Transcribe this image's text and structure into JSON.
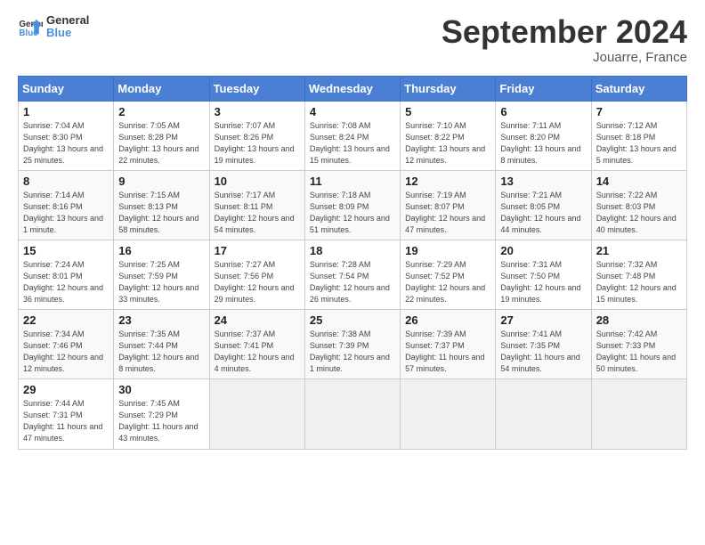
{
  "header": {
    "logo_general": "General",
    "logo_blue": "Blue",
    "month_title": "September 2024",
    "location": "Jouarre, France"
  },
  "days_of_week": [
    "Sunday",
    "Monday",
    "Tuesday",
    "Wednesday",
    "Thursday",
    "Friday",
    "Saturday"
  ],
  "weeks": [
    [
      {
        "day": "1",
        "sunrise": "Sunrise: 7:04 AM",
        "sunset": "Sunset: 8:30 PM",
        "daylight": "Daylight: 13 hours and 25 minutes."
      },
      {
        "day": "2",
        "sunrise": "Sunrise: 7:05 AM",
        "sunset": "Sunset: 8:28 PM",
        "daylight": "Daylight: 13 hours and 22 minutes."
      },
      {
        "day": "3",
        "sunrise": "Sunrise: 7:07 AM",
        "sunset": "Sunset: 8:26 PM",
        "daylight": "Daylight: 13 hours and 19 minutes."
      },
      {
        "day": "4",
        "sunrise": "Sunrise: 7:08 AM",
        "sunset": "Sunset: 8:24 PM",
        "daylight": "Daylight: 13 hours and 15 minutes."
      },
      {
        "day": "5",
        "sunrise": "Sunrise: 7:10 AM",
        "sunset": "Sunset: 8:22 PM",
        "daylight": "Daylight: 13 hours and 12 minutes."
      },
      {
        "day": "6",
        "sunrise": "Sunrise: 7:11 AM",
        "sunset": "Sunset: 8:20 PM",
        "daylight": "Daylight: 13 hours and 8 minutes."
      },
      {
        "day": "7",
        "sunrise": "Sunrise: 7:12 AM",
        "sunset": "Sunset: 8:18 PM",
        "daylight": "Daylight: 13 hours and 5 minutes."
      }
    ],
    [
      {
        "day": "8",
        "sunrise": "Sunrise: 7:14 AM",
        "sunset": "Sunset: 8:16 PM",
        "daylight": "Daylight: 13 hours and 1 minute."
      },
      {
        "day": "9",
        "sunrise": "Sunrise: 7:15 AM",
        "sunset": "Sunset: 8:13 PM",
        "daylight": "Daylight: 12 hours and 58 minutes."
      },
      {
        "day": "10",
        "sunrise": "Sunrise: 7:17 AM",
        "sunset": "Sunset: 8:11 PM",
        "daylight": "Daylight: 12 hours and 54 minutes."
      },
      {
        "day": "11",
        "sunrise": "Sunrise: 7:18 AM",
        "sunset": "Sunset: 8:09 PM",
        "daylight": "Daylight: 12 hours and 51 minutes."
      },
      {
        "day": "12",
        "sunrise": "Sunrise: 7:19 AM",
        "sunset": "Sunset: 8:07 PM",
        "daylight": "Daylight: 12 hours and 47 minutes."
      },
      {
        "day": "13",
        "sunrise": "Sunrise: 7:21 AM",
        "sunset": "Sunset: 8:05 PM",
        "daylight": "Daylight: 12 hours and 44 minutes."
      },
      {
        "day": "14",
        "sunrise": "Sunrise: 7:22 AM",
        "sunset": "Sunset: 8:03 PM",
        "daylight": "Daylight: 12 hours and 40 minutes."
      }
    ],
    [
      {
        "day": "15",
        "sunrise": "Sunrise: 7:24 AM",
        "sunset": "Sunset: 8:01 PM",
        "daylight": "Daylight: 12 hours and 36 minutes."
      },
      {
        "day": "16",
        "sunrise": "Sunrise: 7:25 AM",
        "sunset": "Sunset: 7:59 PM",
        "daylight": "Daylight: 12 hours and 33 minutes."
      },
      {
        "day": "17",
        "sunrise": "Sunrise: 7:27 AM",
        "sunset": "Sunset: 7:56 PM",
        "daylight": "Daylight: 12 hours and 29 minutes."
      },
      {
        "day": "18",
        "sunrise": "Sunrise: 7:28 AM",
        "sunset": "Sunset: 7:54 PM",
        "daylight": "Daylight: 12 hours and 26 minutes."
      },
      {
        "day": "19",
        "sunrise": "Sunrise: 7:29 AM",
        "sunset": "Sunset: 7:52 PM",
        "daylight": "Daylight: 12 hours and 22 minutes."
      },
      {
        "day": "20",
        "sunrise": "Sunrise: 7:31 AM",
        "sunset": "Sunset: 7:50 PM",
        "daylight": "Daylight: 12 hours and 19 minutes."
      },
      {
        "day": "21",
        "sunrise": "Sunrise: 7:32 AM",
        "sunset": "Sunset: 7:48 PM",
        "daylight": "Daylight: 12 hours and 15 minutes."
      }
    ],
    [
      {
        "day": "22",
        "sunrise": "Sunrise: 7:34 AM",
        "sunset": "Sunset: 7:46 PM",
        "daylight": "Daylight: 12 hours and 12 minutes."
      },
      {
        "day": "23",
        "sunrise": "Sunrise: 7:35 AM",
        "sunset": "Sunset: 7:44 PM",
        "daylight": "Daylight: 12 hours and 8 minutes."
      },
      {
        "day": "24",
        "sunrise": "Sunrise: 7:37 AM",
        "sunset": "Sunset: 7:41 PM",
        "daylight": "Daylight: 12 hours and 4 minutes."
      },
      {
        "day": "25",
        "sunrise": "Sunrise: 7:38 AM",
        "sunset": "Sunset: 7:39 PM",
        "daylight": "Daylight: 12 hours and 1 minute."
      },
      {
        "day": "26",
        "sunrise": "Sunrise: 7:39 AM",
        "sunset": "Sunset: 7:37 PM",
        "daylight": "Daylight: 11 hours and 57 minutes."
      },
      {
        "day": "27",
        "sunrise": "Sunrise: 7:41 AM",
        "sunset": "Sunset: 7:35 PM",
        "daylight": "Daylight: 11 hours and 54 minutes."
      },
      {
        "day": "28",
        "sunrise": "Sunrise: 7:42 AM",
        "sunset": "Sunset: 7:33 PM",
        "daylight": "Daylight: 11 hours and 50 minutes."
      }
    ],
    [
      {
        "day": "29",
        "sunrise": "Sunrise: 7:44 AM",
        "sunset": "Sunset: 7:31 PM",
        "daylight": "Daylight: 11 hours and 47 minutes."
      },
      {
        "day": "30",
        "sunrise": "Sunrise: 7:45 AM",
        "sunset": "Sunset: 7:29 PM",
        "daylight": "Daylight: 11 hours and 43 minutes."
      },
      null,
      null,
      null,
      null,
      null
    ]
  ]
}
